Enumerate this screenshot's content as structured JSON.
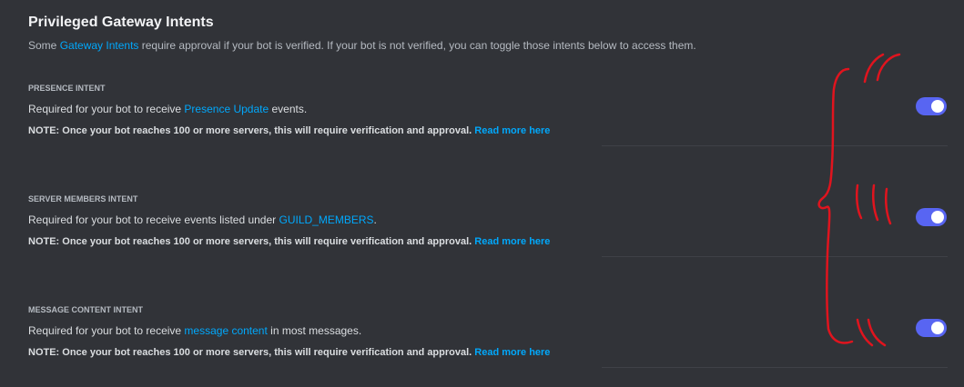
{
  "header": {
    "title": "Privileged Gateway Intents",
    "intro_prefix": "Some ",
    "intro_link": "Gateway Intents",
    "intro_suffix": " require approval if your bot is verified. If your bot is not verified, you can toggle those intents below to access them."
  },
  "note_text": "NOTE: Once your bot reaches 100 or more servers, this will require verification and approval. ",
  "read_more_label": "Read more here",
  "intents": [
    {
      "heading": "PRESENCE INTENT",
      "desc_prefix": "Required for your bot to receive ",
      "desc_link": "Presence Update",
      "desc_suffix": " events.",
      "enabled": true
    },
    {
      "heading": "SERVER MEMBERS INTENT",
      "desc_prefix": "Required for your bot to receive events listed under ",
      "desc_link": "GUILD_MEMBERS",
      "desc_suffix": ".",
      "enabled": true
    },
    {
      "heading": "MESSAGE CONTENT INTENT",
      "desc_prefix": "Required for your bot to receive ",
      "desc_link": "message content",
      "desc_suffix": " in most messages.",
      "enabled": true
    }
  ],
  "colors": {
    "background": "#313338",
    "link": "#00a8fc",
    "toggle_on": "#5865f2",
    "annotation": "#e0141e"
  }
}
